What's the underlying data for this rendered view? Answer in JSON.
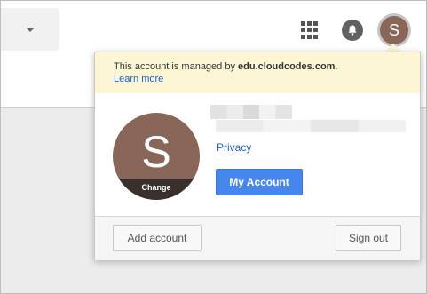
{
  "header": {
    "apps_icon": "apps-grid-icon",
    "notifications_icon": "bell-icon",
    "avatar_letter": "S"
  },
  "account_popup": {
    "notice_prefix": "This account is managed by ",
    "managed_domain": "edu.cloudcodes.com",
    "notice_suffix": ".",
    "learn_more": "Learn more",
    "avatar_letter": "S",
    "change_label": "Change",
    "privacy_link": "Privacy",
    "my_account_button": "My Account",
    "add_account_button": "Add account",
    "sign_out_button": "Sign out"
  },
  "colors": {
    "avatar": "#8a6659",
    "primary_button": "#4787ed",
    "notice_background": "#fdf6d5"
  }
}
